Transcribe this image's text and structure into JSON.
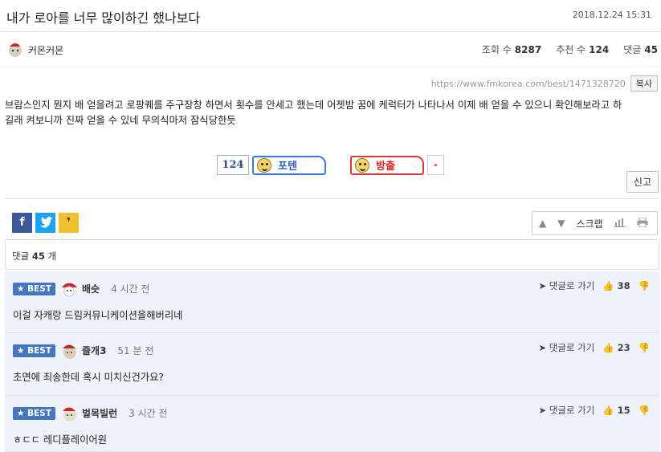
{
  "post": {
    "title": "내가 로아를 너무 많이하긴 했나보다",
    "date": "2018.12.24 15:31",
    "author": "커몬커몬",
    "views_label": "조회 수",
    "views": "8287",
    "recommend_label": "추천 수",
    "recommend": "124",
    "comments_label": "댓글",
    "comments": "45",
    "url": "https://www.fmkorea.com/best/1471328720",
    "copy_label": "복사",
    "body_line1": "브람스인지 뭔지 배 얻을려고 로팡퀘를 주구장창 하면서 횟수를 안세고 했는데 어젯밤 꿈에 케럭터가 나타나서 이제 배 얻을 수 있으니 확인해보라고 하",
    "body_line2": "길래 켜보니까 진짜 얻을 수 있네 무의식마저 잠식당한듯"
  },
  "votes": {
    "count": "124",
    "up_label": "포텐",
    "down_label": "방출",
    "minus": "-"
  },
  "report_label": "신고",
  "tools": {
    "scrap_label": "스크랩"
  },
  "comment_summary": {
    "prefix": "댓글",
    "count": "45",
    "suffix": "개"
  },
  "comments": [
    {
      "badge": "BEST",
      "name": "배슷",
      "time": "4 시간 전",
      "reply_label": "댓글로 가기",
      "likes": "38",
      "text": "이걸 자캐랑 드림커뮤니케이션을해버리네"
    },
    {
      "badge": "BEST",
      "name": "즐개3",
      "time": "51 분 전",
      "reply_label": "댓글로 가기",
      "likes": "23",
      "text": "초면에 죄송한데 혹시 미치신건가요?"
    },
    {
      "badge": "BEST",
      "name": "벌목빌런",
      "time": "3 시간 전",
      "reply_label": "댓글로 가기",
      "likes": "15",
      "text": "ㅎㄷㄷ 레디플레이어원"
    }
  ],
  "colors": {
    "best_badge": "#4676c0",
    "comment_bg": "#eef2f9",
    "potent": "#3a7bd5",
    "bang": "#d63b3b"
  }
}
